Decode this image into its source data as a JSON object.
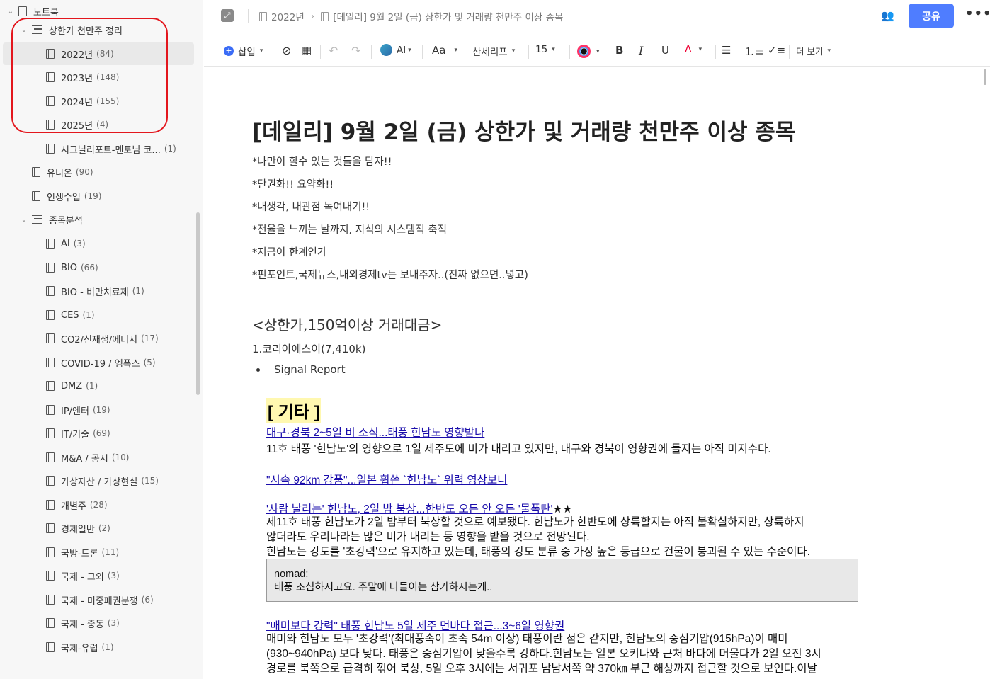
{
  "sidebar": {
    "root": {
      "label": "노트북"
    },
    "items": [
      {
        "label": "상한가 천만주 정리",
        "count": "",
        "type": "stack",
        "expanded": true
      },
      {
        "label": "2022년",
        "count": "(84)",
        "type": "doc"
      },
      {
        "label": "2023년",
        "count": "(148)",
        "type": "doc"
      },
      {
        "label": "2024년",
        "count": "(155)",
        "type": "doc"
      },
      {
        "label": "2025년",
        "count": "(4)",
        "type": "doc"
      },
      {
        "label": "시그널리포트-멘토님 코...",
        "count": "(1)",
        "type": "doc"
      },
      {
        "label": "유니온",
        "count": "(90)",
        "type": "doc"
      },
      {
        "label": "인생수업",
        "count": "(19)",
        "type": "doc"
      },
      {
        "label": "종목분석",
        "count": "",
        "type": "stack",
        "expanded": true
      },
      {
        "label": "AI",
        "count": "(3)",
        "type": "doc"
      },
      {
        "label": "BIO",
        "count": "(66)",
        "type": "doc"
      },
      {
        "label": "BIO - 비만치료제",
        "count": "(1)",
        "type": "doc"
      },
      {
        "label": "CES",
        "count": "(1)",
        "type": "doc"
      },
      {
        "label": "CO2/신재생/에너지",
        "count": "(17)",
        "type": "doc"
      },
      {
        "label": "COVID-19 / 엠폭스",
        "count": "(5)",
        "type": "doc"
      },
      {
        "label": "DMZ",
        "count": "(1)",
        "type": "doc"
      },
      {
        "label": "IP/엔터",
        "count": "(19)",
        "type": "doc"
      },
      {
        "label": "IT/기술",
        "count": "(69)",
        "type": "doc"
      },
      {
        "label": "M&A / 공시",
        "count": "(10)",
        "type": "doc"
      },
      {
        "label": "가상자산 / 가상현실",
        "count": "(15)",
        "type": "doc"
      },
      {
        "label": "개별주",
        "count": "(28)",
        "type": "doc"
      },
      {
        "label": "경제일반",
        "count": "(2)",
        "type": "doc"
      },
      {
        "label": "국방-드론",
        "count": "(11)",
        "type": "doc"
      },
      {
        "label": "국제 - 그외",
        "count": "(3)",
        "type": "doc"
      },
      {
        "label": "국제 - 미중패권분쟁",
        "count": "(6)",
        "type": "doc"
      },
      {
        "label": "국제 - 중동",
        "count": "(3)",
        "type": "doc"
      },
      {
        "label": "국제-유럽",
        "count": "(1)",
        "type": "doc"
      }
    ]
  },
  "topbar": {
    "breadcrumb_parent": "2022년",
    "breadcrumb_sep": "›",
    "breadcrumb_current": "[데일리] 9월 2일 (금) 상한가 및 거래량 천만주 이상 종목",
    "share_label": "공유",
    "more_label": "•••"
  },
  "toolbar": {
    "insert": "삽입",
    "ai": "AI",
    "font_size_label": "Aa",
    "font_family": "산세리프",
    "font_size": "15",
    "bold": "B",
    "italic": "I",
    "underline": "U",
    "more_view": "더 보기"
  },
  "doc": {
    "title": "[데일리] 9월 2일 (금) 상한가 및 거래량 천만주 이상 종목",
    "notes": [
      "*나만이 할수 있는 것들을 담자!!",
      "*단권화!! 요약화!!",
      "*내생각, 내관점 녹여내기!!",
      "*전율을 느끼는 날까지, 지식의 시스템적 축적",
      "*지금이 한계인가",
      "*핀포인트,국제뉴스,내외경제tv는 보내주자..(진짜 없으면..넣고)"
    ],
    "section_heading": "<상한가,150억이상 거래대금>",
    "item1": "1.코리아에스이(7,410k)",
    "bullet1": "Signal Report",
    "report": {
      "tag": "[ 기타 ]",
      "link1": "대구·경북 2~5일 비 소식...태풍 힌남노 영향받나",
      "text1": "11호 태풍 '힌남노'의 영향으로 1일 제주도에 비가 내리고 있지만, 대구와 경북이 영향권에 들지는 아직 미지수다.",
      "link2": "\"시속 92km 강풍\"...일본 휩쓴 `힌남노` 위력 영상보니",
      "link3": "'사람 날리는' 힌남노, 2일 밤 북상...한반도 오든 안 오든 '물폭탄'",
      "link3_stars": " ★★",
      "text3a": "제11호 태풍 힌남노가 2일 밤부터 북상할 것으로 예보됐다. 힌남노가 한반도에 상륙할지는 아직 불확실하지만, 상륙하지",
      "text3b": "않더라도 우리나라는 많은 비가 내리는 등 영향을 받을 것으로 전망된다.",
      "text3c": "힌남노는 강도를 '초강력'으로 유지하고 있는데, 태풍의 강도 분류 중 가장 높은 등급으로 건물이 붕괴될 수 있는 수준이다.",
      "quote_author": "nomad:",
      "quote_text": "태풍 조심하시고요. 주말에 나들이는 삼가하시는게..",
      "link4": "\"매미보다 강력\" 태풍 힌남노 5일 제주 먼바다 접근...3~6일 영향권",
      "text4a": "매미와 힌남노 모두 '초강력'(최대풍속이 초속 54m 이상) 태풍이란 점은 같지만, 힌남노의 중심기압(915hPa)이 매미",
      "text4b": "(930~940hPa) 보다 낮다. 태풍은 중심기압이 낮을수록 강하다.힌남노는 일본 오키나와 근처 바다에 머물다가 2일 오전 3시",
      "text4c": "경로를 북쪽으로 급격히 꺾어 북상, 5일 오후 3시에는 서귀포 남남서쪽 약 370㎞ 부근 해상까지 접근할 것으로 보인다.이날"
    }
  },
  "colors": {
    "accent": "#4f7dff",
    "highlight_box": "#e3161d",
    "link": "#1a0dab",
    "tag_bg": "#fff8b0"
  }
}
